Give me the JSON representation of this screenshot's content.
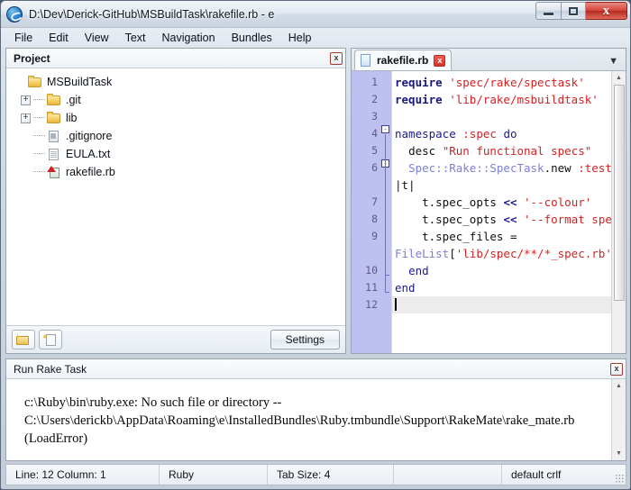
{
  "window": {
    "title": "D:\\Dev\\Derick-GitHub\\MSBuildTask\\rakefile.rb - e",
    "app_icon": "e-app-icon",
    "controls": {
      "minimize": "–",
      "maximize": "❐",
      "close": "x"
    }
  },
  "menubar": {
    "items": [
      "File",
      "Edit",
      "View",
      "Text",
      "Navigation",
      "Bundles",
      "Help"
    ]
  },
  "project_panel": {
    "title": "Project",
    "close_label": "x",
    "tree": [
      {
        "label": "MSBuildTask",
        "icon": "folder-icon",
        "level": 0,
        "expander": "none"
      },
      {
        "label": ".git",
        "icon": "folder-icon",
        "level": 1,
        "expander": "+"
      },
      {
        "label": "lib",
        "icon": "folder-icon",
        "level": 1,
        "expander": "+"
      },
      {
        "label": ".gitignore",
        "icon": "gitignore-file-icon",
        "level": 1,
        "expander": "none"
      },
      {
        "label": "EULA.txt",
        "icon": "text-file-icon",
        "level": 1,
        "expander": "none"
      },
      {
        "label": "rakefile.rb",
        "icon": "ruby-file-icon",
        "level": 1,
        "expander": "none"
      }
    ],
    "toolbar": {
      "new_folder_icon": "new-folder-icon",
      "new_file_icon": "new-file-icon",
      "settings_label": "Settings"
    }
  },
  "editor": {
    "tab": {
      "label": "rakefile.rb",
      "close_label": "x",
      "file_icon": "file-icon"
    },
    "tab_menu_icon": "chevron-down-icon",
    "line_numbers": [
      "1",
      "2",
      "3",
      "4",
      "5",
      "6",
      "7",
      "8",
      "9",
      "10",
      "11",
      "12"
    ],
    "fold_markers": [
      {
        "line": 4,
        "glyph": "-"
      },
      {
        "line": 6,
        "glyph": "-"
      }
    ],
    "lines": [
      "require 'spec/rake/spectask'",
      "require 'lib/rake/msbuildtask'",
      "",
      "namespace :spec do",
      "  desc \"Run functional specs\"",
      "  Spec::Rake::SpecTask.new :test do |t|",
      "    t.spec_opts << '--colour'",
      "    t.spec_opts << '--format specdoc'",
      "    t.spec_files = FileList['lib/spec/**/*_spec.rb']",
      "  end",
      "end",
      ""
    ],
    "current_line": 12,
    "colors": {
      "gutter_bg": "#bfc0f2",
      "gutter_fg": "#5a5a82",
      "keyword": "#19197a",
      "string": "#d62020",
      "symbol": "#d62020",
      "class": "#7b7fd6",
      "current_line_bg": "#ececec"
    }
  },
  "output_panel": {
    "title": "Run Rake Task",
    "close_label": "x",
    "text_lines": [
      "c:\\Ruby\\bin\\ruby.exe: No such file or directory --",
      "C:\\Users\\derickb\\AppData\\Roaming\\e\\InstalledBundles\\Ruby.tmbundle\\Support\\RakeMate\\rake_mate.rb",
      "(LoadError)"
    ],
    "scroll_up_icon": "scroll-up-arrow-icon",
    "scroll_down_icon": "scroll-down-arrow-icon"
  },
  "statusbar": {
    "position": "Line: 12  Column: 1",
    "language": "Ruby",
    "tab_size": "Tab Size: 4",
    "blank": "",
    "line_endings": "default crlf"
  }
}
